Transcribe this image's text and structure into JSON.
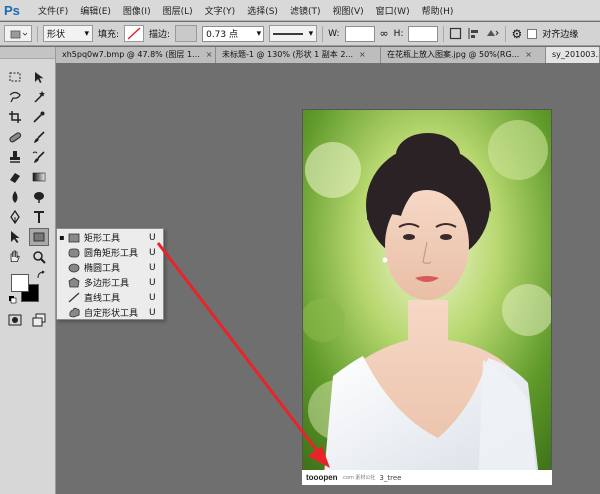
{
  "app": {
    "logo": "Ps"
  },
  "menu": [
    "文件(F)",
    "编辑(E)",
    "图像(I)",
    "图层(L)",
    "文字(Y)",
    "选择(S)",
    "滤镜(T)",
    "视图(V)",
    "窗口(W)",
    "帮助(H)"
  ],
  "options": {
    "mode_value": "形状",
    "fill_label": "填充:",
    "stroke_label": "描边:",
    "stroke_width": "0.73 点",
    "w_label": "W:",
    "h_label": "H:",
    "align_edges_label": "对齐边缘"
  },
  "tabs": [
    {
      "label": "xh5pq0w7.bmp @ 47.8% (图层 1...",
      "close": "×"
    },
    {
      "label": "未标题-1 @ 130% (形状 1 副本 2...",
      "close": "×"
    },
    {
      "label": "在花瓶上放入图案.jpg @ 50%(RG...",
      "close": "×"
    },
    {
      "label": "sy_201003...",
      "close": ""
    }
  ],
  "flyout": {
    "items": [
      {
        "label": "矩形工具",
        "key": "U",
        "selected": true,
        "icon": "rectangle-icon"
      },
      {
        "label": "圆角矩形工具",
        "key": "U",
        "selected": false,
        "icon": "rounded-rectangle-icon"
      },
      {
        "label": "椭圆工具",
        "key": "U",
        "selected": false,
        "icon": "ellipse-icon"
      },
      {
        "label": "多边形工具",
        "key": "U",
        "selected": false,
        "icon": "polygon-icon"
      },
      {
        "label": "直线工具",
        "key": "U",
        "selected": false,
        "icon": "line-icon"
      },
      {
        "label": "自定形状工具",
        "key": "U",
        "selected": false,
        "icon": "custom-shape-icon"
      }
    ],
    "bullet": "▪"
  },
  "canvas": {
    "watermark_logo": "tooopen",
    "watermark_domain": ".com 素材公社",
    "watermark_id": "3_tree"
  },
  "colors": {
    "arrow": "#e8242a",
    "ps_blue": "#1c6bb5",
    "foreground": "#000000",
    "background": "#ffffff"
  }
}
